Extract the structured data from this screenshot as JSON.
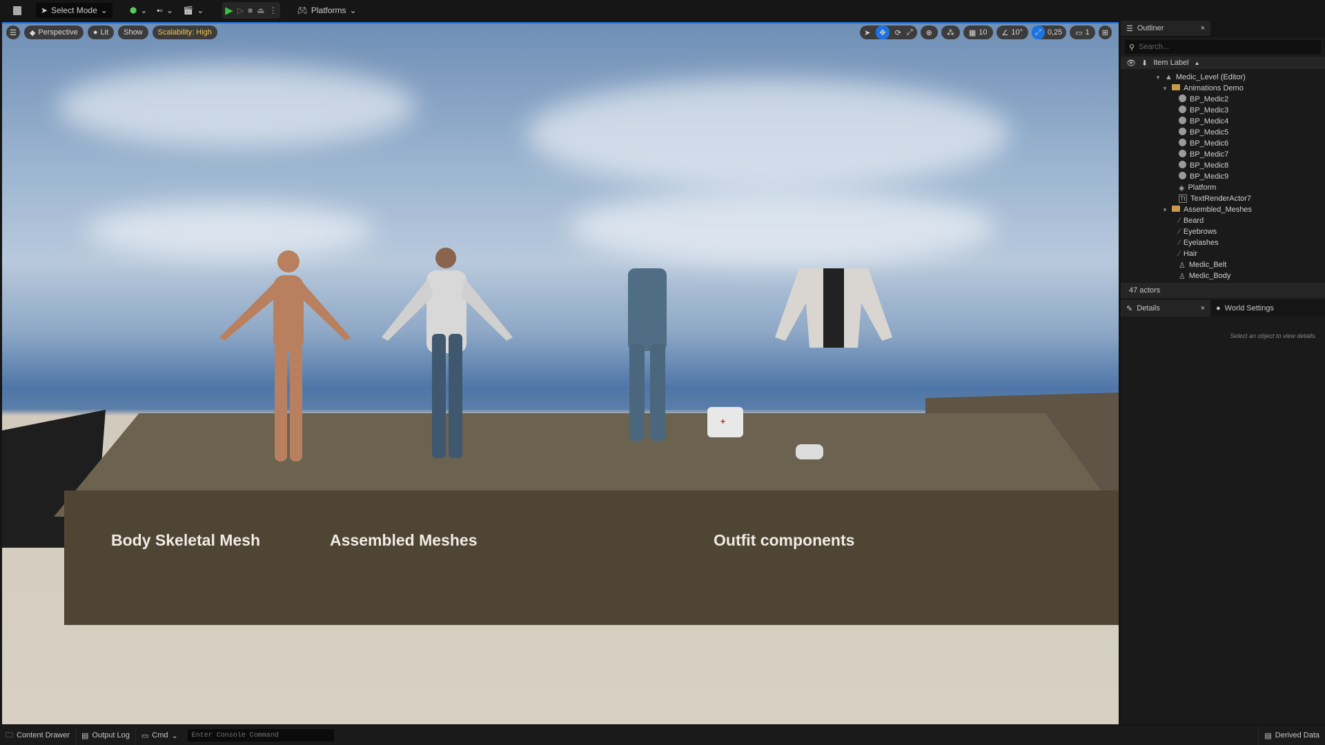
{
  "toolbar": {
    "select_mode": "Select Mode",
    "platforms": "Platforms"
  },
  "viewport": {
    "perspective": "Perspective",
    "lit": "Lit",
    "show": "Show",
    "scalability": "Scalability: High",
    "grid_snap": "10",
    "rotation_snap": "10°",
    "scale_snap": "0,25",
    "camera_speed": "1",
    "labels": [
      "Body Skeletal Mesh",
      "Assembled Meshes",
      "Outfit components"
    ]
  },
  "outliner": {
    "tab": "Outliner",
    "search_placeholder": "Search...",
    "column": "Item Label",
    "items": [
      {
        "label": "Medic_Level (Editor)",
        "icon": "level-icon",
        "depth": 0
      },
      {
        "label": "Animations Demo",
        "icon": "folder-icon",
        "depth": 1
      },
      {
        "label": "BP_Medic2",
        "icon": "blueprint-icon",
        "depth": 2
      },
      {
        "label": "BP_Medic3",
        "icon": "blueprint-icon",
        "depth": 2
      },
      {
        "label": "BP_Medic4",
        "icon": "blueprint-icon",
        "depth": 2
      },
      {
        "label": "BP_Medic5",
        "icon": "blueprint-icon",
        "depth": 2
      },
      {
        "label": "BP_Medic6",
        "icon": "blueprint-icon",
        "depth": 2
      },
      {
        "label": "BP_Medic7",
        "icon": "blueprint-icon",
        "depth": 2
      },
      {
        "label": "BP_Medic8",
        "icon": "blueprint-icon",
        "depth": 2
      },
      {
        "label": "BP_Medic9",
        "icon": "blueprint-icon",
        "depth": 2
      },
      {
        "label": "Platform",
        "icon": "static-mesh-icon",
        "depth": 2
      },
      {
        "label": "TextRenderActor7",
        "icon": "text-render-icon",
        "depth": 2
      },
      {
        "label": "Assembled_Meshes",
        "icon": "folder-icon",
        "depth": 1
      },
      {
        "label": "Beard",
        "icon": "groom-icon",
        "depth": 2
      },
      {
        "label": "Eyebrows",
        "icon": "groom-icon",
        "depth": 2
      },
      {
        "label": "Eyelashes",
        "icon": "groom-icon",
        "depth": 2
      },
      {
        "label": "Hair",
        "icon": "groom-icon",
        "depth": 2
      },
      {
        "label": "Medic_Belt",
        "icon": "skeletal-mesh-icon",
        "depth": 2
      },
      {
        "label": "Medic_Body",
        "icon": "skeletal-mesh-icon",
        "depth": 2
      }
    ],
    "count": "47 actors"
  },
  "details": {
    "tab": "Details",
    "world_settings": "World Settings",
    "hint": "Select an object to view details."
  },
  "bottom": {
    "content_drawer": "Content Drawer",
    "output_log": "Output Log",
    "cmd": "Cmd",
    "console_placeholder": "Enter Console Command",
    "derived_data": "Derived Data"
  }
}
